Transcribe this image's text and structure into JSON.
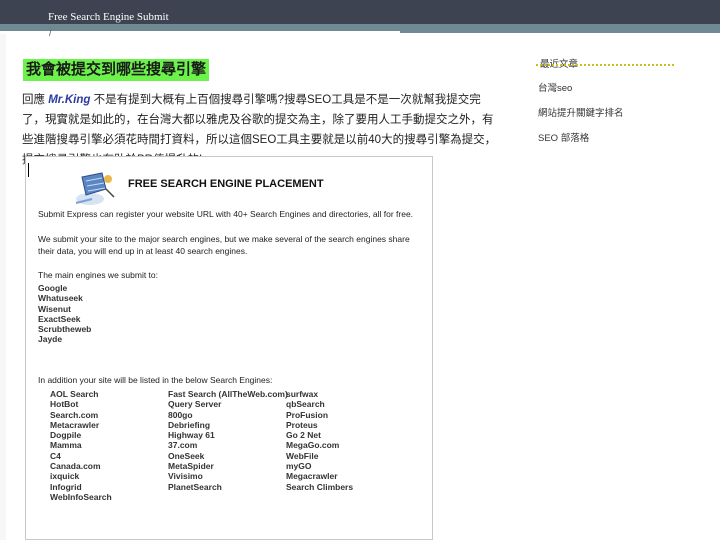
{
  "header": {
    "title": "Free Search Engine Submit",
    "tick": "/"
  },
  "main": {
    "heading": "我會被提交到哪些搜尋引擎",
    "para_before": "回應",
    "para_brand": "Mr.King",
    "para_after": " 不是有提到大概有上百個搜尋引擎嗎?搜尋SEO工具是不是一次就幫我提交完了，現實就是如此的，在台灣大都以雅虎及谷歌的提交為主，除了要用人工手動提交之外，有些進階搜尋引擎必須花時間打資料，所以這個SEO工具主要就是以前40大的搜尋引擎為提交，提交搜尋引擎也有助於PR值提升的!"
  },
  "sidebar": {
    "heading": "最近文章",
    "links": [
      "台灣seo",
      "網站提升關鍵字排名",
      "SEO 部落格"
    ]
  },
  "screenshot": {
    "title": "FREE SEARCH ENGINE PLACEMENT",
    "line1": "Submit Express can register your website URL with 40+ Search Engines and directories, all for free.",
    "line2a": "We submit your site to the major search engines, but we make several of the search engines share",
    "line2b": "their data, you will end up in at least 40 search engines.",
    "line3": "The main engines we submit to:",
    "main_engines": [
      "Google",
      "Whatuseek",
      "Wisenut",
      "ExactSeek",
      "Scrubtheweb",
      "Jayde"
    ],
    "line4": "In addition your site will be listed in the below Search Engines:",
    "col1": [
      "AOL Search",
      "HotBot",
      "Search.com",
      "Metacrawler",
      "Dogpile",
      "Mamma",
      "C4",
      "Canada.com",
      "ixquick",
      "Infogrid",
      "WebInfoSearch"
    ],
    "col2": [
      "Fast Search (AllTheWeb.com)",
      "Query Server",
      "800go",
      "Debriefing",
      "Highway 61",
      "37.com",
      "OneSeek",
      "MetaSpider",
      "Vivisimo",
      "PlanetSearch"
    ],
    "col3": [
      "surfwax",
      "qbSearch",
      "ProFusion",
      "Proteus",
      "Go 2 Net",
      "MegaGo.com",
      "WebFile",
      "myGO",
      "Megacrawler",
      "Search Climbers"
    ]
  },
  "colors": {
    "topbar": "#3d4350",
    "accent": "#6f8a93",
    "heading_bg": "#6cf24b",
    "brand": "#2b3a9e"
  }
}
